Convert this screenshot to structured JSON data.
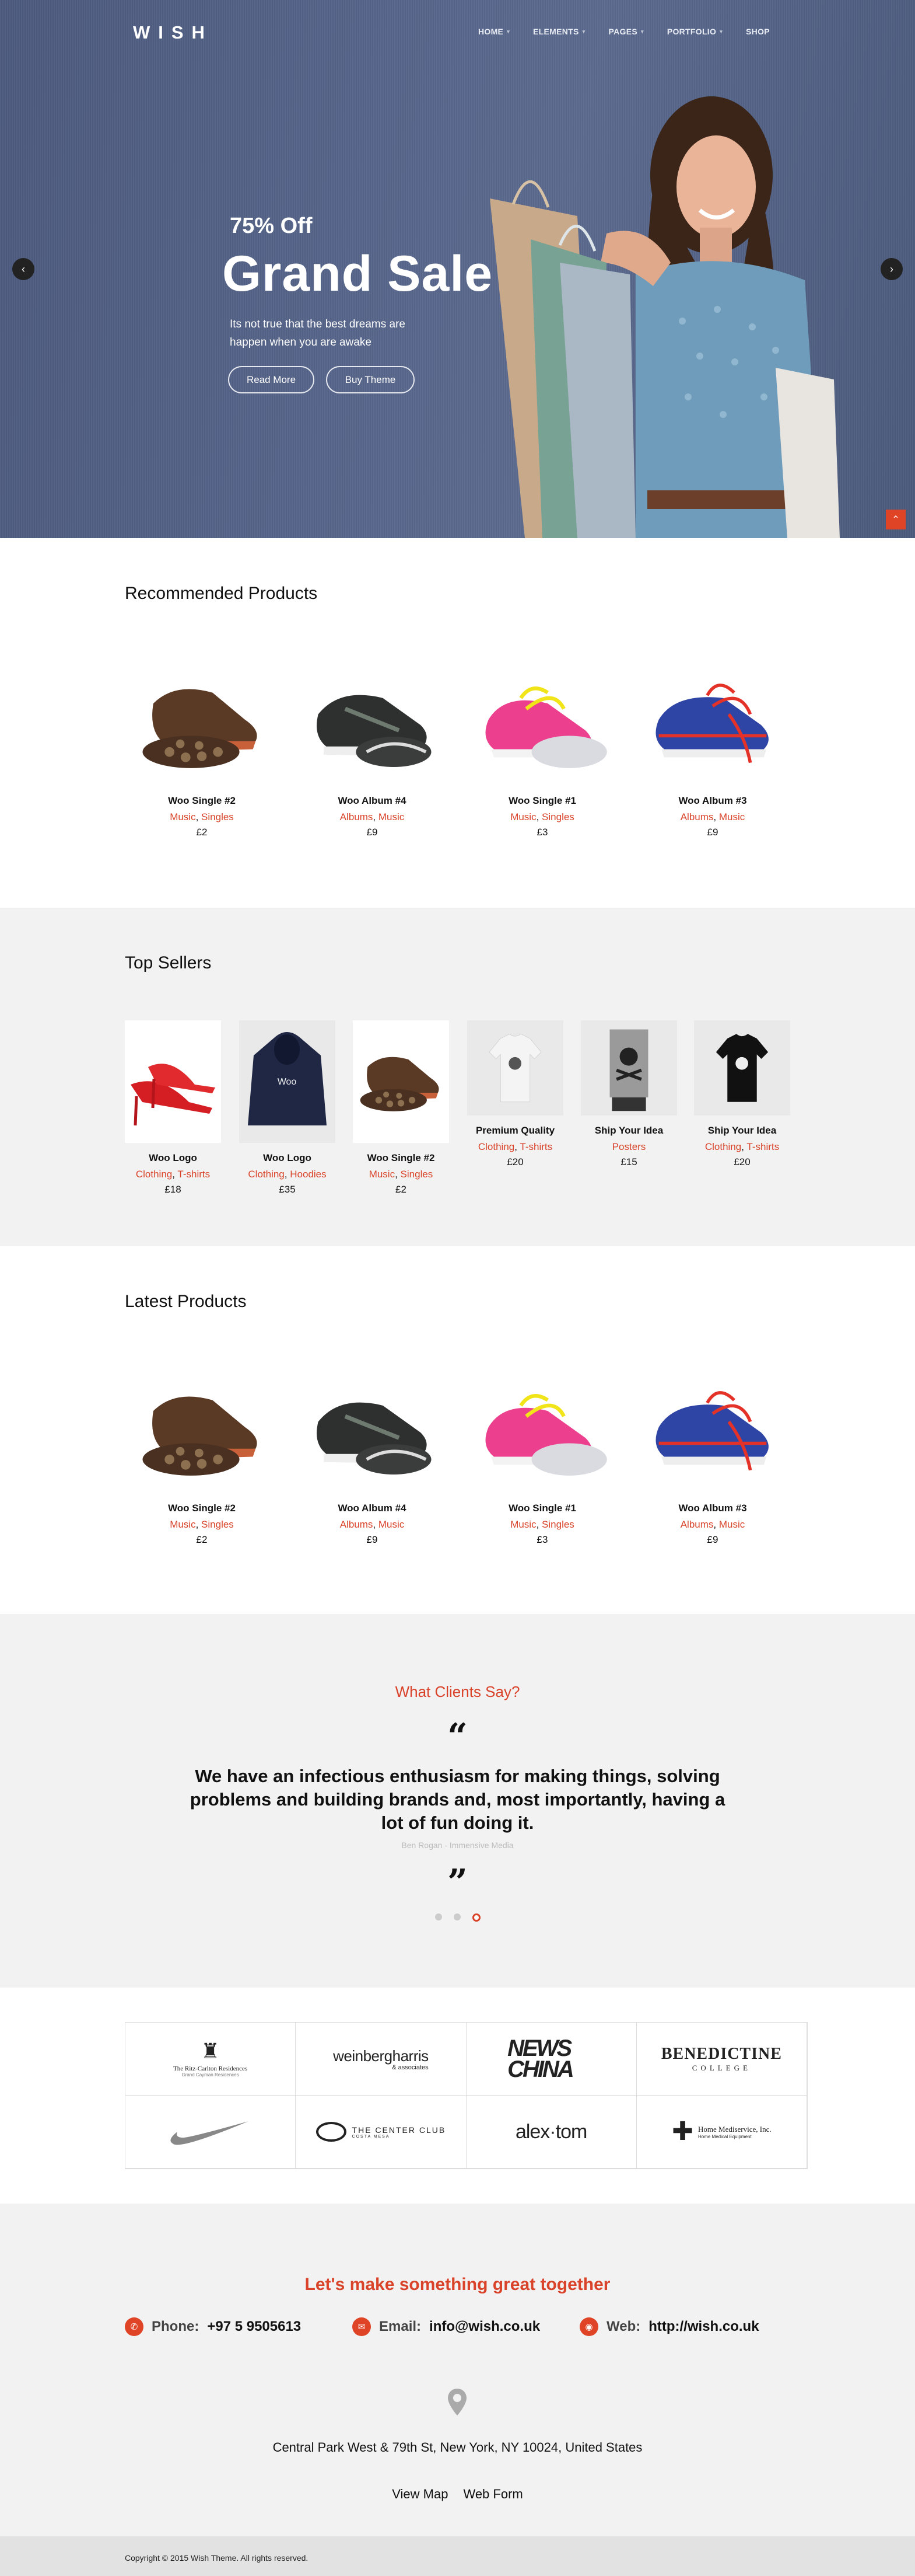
{
  "header": {
    "logo": "WISH",
    "nav": [
      {
        "label": "HOME",
        "dropdown": true
      },
      {
        "label": "ELEMENTS",
        "dropdown": true
      },
      {
        "label": "PAGES",
        "dropdown": true
      },
      {
        "label": "PORTFOLIO",
        "dropdown": true
      },
      {
        "label": "SHOP",
        "dropdown": false
      }
    ]
  },
  "hero": {
    "subtitle": "75% Off",
    "title": "Grand Sale",
    "description": "Its not true that the best dreams are happen when you are awake",
    "btn_read_more": "Read More",
    "btn_buy_theme": "Buy Theme",
    "prev_icon": "chevron-left-icon",
    "next_icon": "chevron-right-icon"
  },
  "recommended": {
    "title": "Recommended Products",
    "products": [
      {
        "name": "Woo Single #2",
        "cats": [
          "Music",
          "Singles"
        ],
        "price": "£2",
        "image": "brown-shoe"
      },
      {
        "name": "Woo Album #4",
        "cats": [
          "Albums",
          "Music"
        ],
        "price": "£9",
        "image": "black-sneaker"
      },
      {
        "name": "Woo Single #1",
        "cats": [
          "Music",
          "Singles"
        ],
        "price": "£3",
        "image": "pink-sneaker"
      },
      {
        "name": "Woo Album #3",
        "cats": [
          "Albums",
          "Music"
        ],
        "price": "£9",
        "image": "blue-sneaker"
      }
    ]
  },
  "top_sellers": {
    "title": "Top Sellers",
    "products": [
      {
        "name": "Woo Logo",
        "cats": [
          "Clothing",
          "T-shirts"
        ],
        "price": "£18",
        "image": "red-heels"
      },
      {
        "name": "Woo Logo",
        "cats": [
          "Clothing",
          "Hoodies"
        ],
        "price": "£35",
        "image": "hoodie"
      },
      {
        "name": "Woo Single #2",
        "cats": [
          "Music",
          "Singles"
        ],
        "price": "£2",
        "image": "brown-shoe"
      },
      {
        "name": "Premium Quality",
        "cats": [
          "Clothing",
          "T-shirts"
        ],
        "price": "£20",
        "image": "white-tshirt"
      },
      {
        "name": "Ship Your Idea",
        "cats": [
          "Posters"
        ],
        "price": "£15",
        "image": "poster"
      },
      {
        "name": "Ship Your Idea",
        "cats": [
          "Clothing",
          "T-shirts"
        ],
        "price": "£20",
        "image": "black-tshirt"
      }
    ]
  },
  "latest": {
    "title": "Latest Products",
    "products": [
      {
        "name": "Woo Single #2",
        "cats": [
          "Music",
          "Singles"
        ],
        "price": "£2",
        "image": "brown-shoe"
      },
      {
        "name": "Woo Album #4",
        "cats": [
          "Albums",
          "Music"
        ],
        "price": "£9",
        "image": "black-sneaker"
      },
      {
        "name": "Woo Single #1",
        "cats": [
          "Music",
          "Singles"
        ],
        "price": "£3",
        "image": "pink-sneaker"
      },
      {
        "name": "Woo Album #3",
        "cats": [
          "Albums",
          "Music"
        ],
        "price": "£9",
        "image": "blue-sneaker"
      }
    ]
  },
  "testimonials": {
    "heading": "What Clients Say?",
    "quote": "We have an infectious enthusiasm for making things, solving problems and building brands and, most importantly, having a lot of fun doing it.",
    "author": "Ben Rogan - Immensive Media",
    "active_dot": 3,
    "dots": 3
  },
  "clients": [
    {
      "name": "The Ritz-Carlton Residences",
      "sub": "Grand Cayman Residences"
    },
    {
      "name": "weinbergharris",
      "sub": "& associates"
    },
    {
      "name": "NEWS CHINA",
      "sub": ""
    },
    {
      "name": "BENEDICTINE",
      "sub": "COLLEGE"
    },
    {
      "name": "swoosh-logo",
      "sub": ""
    },
    {
      "name": "THE CENTER CLUB",
      "sub": "COSTA MESA"
    },
    {
      "name": "alex·tom",
      "sub": ""
    },
    {
      "name": "Home Mediservice, Inc.",
      "sub": "Home Medical Equipment"
    }
  ],
  "contact": {
    "heading": "Let's make something great together",
    "phone_label": "Phone:",
    "phone": "+97 5 9505613",
    "email_label": "Email:",
    "email": "info@wish.co.uk",
    "web_label": "Web:",
    "web": "http://wish.co.uk",
    "address": "Central Park West & 79th St, New York, NY 10024, United States",
    "view_map": "View Map",
    "web_form": "Web Form"
  },
  "footer": {
    "copyright": "Copyright © 2015 Wish Theme. All rights reserved."
  },
  "colors": {
    "accent": "#d9432a",
    "hero": "#56658a",
    "gray_bg": "#f2f2f2"
  }
}
